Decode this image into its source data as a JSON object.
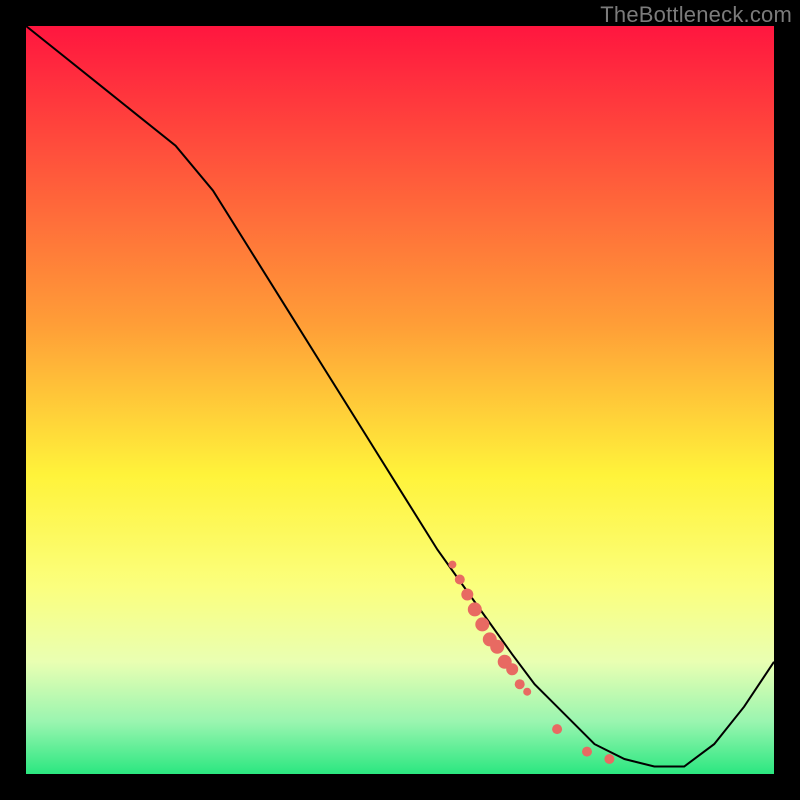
{
  "watermark": "TheBottleneck.com",
  "colors": {
    "red_top": "#ff163f",
    "orange": "#ffb338",
    "yellow": "#fffa3b",
    "pale_yellow": "#fbffa9",
    "pale_green": "#d9ffba",
    "green": "#2be780",
    "line": "#000000",
    "marker": "#e86a62",
    "frame": "#000000"
  },
  "chart_data": {
    "type": "line",
    "title": "",
    "xlabel": "",
    "ylabel": "",
    "xlim": [
      0,
      100
    ],
    "ylim": [
      0,
      100
    ],
    "series": [
      {
        "name": "curve",
        "x": [
          0,
          5,
          10,
          15,
          20,
          25,
          30,
          35,
          40,
          45,
          50,
          55,
          60,
          65,
          68,
          70,
          73,
          76,
          80,
          84,
          88,
          92,
          96,
          100
        ],
        "values": [
          100,
          96,
          92,
          88,
          84,
          78,
          70,
          62,
          54,
          46,
          38,
          30,
          23,
          16,
          12,
          10,
          7,
          4,
          2,
          1,
          1,
          4,
          9,
          15
        ]
      }
    ],
    "markers": [
      {
        "x": 57,
        "y": 28,
        "size": 4
      },
      {
        "x": 58,
        "y": 26,
        "size": 5
      },
      {
        "x": 59,
        "y": 24,
        "size": 6
      },
      {
        "x": 60,
        "y": 22,
        "size": 7
      },
      {
        "x": 61,
        "y": 20,
        "size": 7
      },
      {
        "x": 62,
        "y": 18,
        "size": 7
      },
      {
        "x": 63,
        "y": 17,
        "size": 7
      },
      {
        "x": 64,
        "y": 15,
        "size": 7
      },
      {
        "x": 65,
        "y": 14,
        "size": 6
      },
      {
        "x": 66,
        "y": 12,
        "size": 5
      },
      {
        "x": 67,
        "y": 11,
        "size": 4
      },
      {
        "x": 71,
        "y": 6,
        "size": 5
      },
      {
        "x": 75,
        "y": 3,
        "size": 5
      },
      {
        "x": 78,
        "y": 2,
        "size": 5
      }
    ],
    "gradient_stops": [
      {
        "pct": 0,
        "color": "#ff163f"
      },
      {
        "pct": 40,
        "color": "#ff9e37"
      },
      {
        "pct": 60,
        "color": "#fff33a"
      },
      {
        "pct": 75,
        "color": "#fbff7e"
      },
      {
        "pct": 85,
        "color": "#e9ffb2"
      },
      {
        "pct": 93,
        "color": "#9af5b0"
      },
      {
        "pct": 100,
        "color": "#2be780"
      }
    ]
  }
}
